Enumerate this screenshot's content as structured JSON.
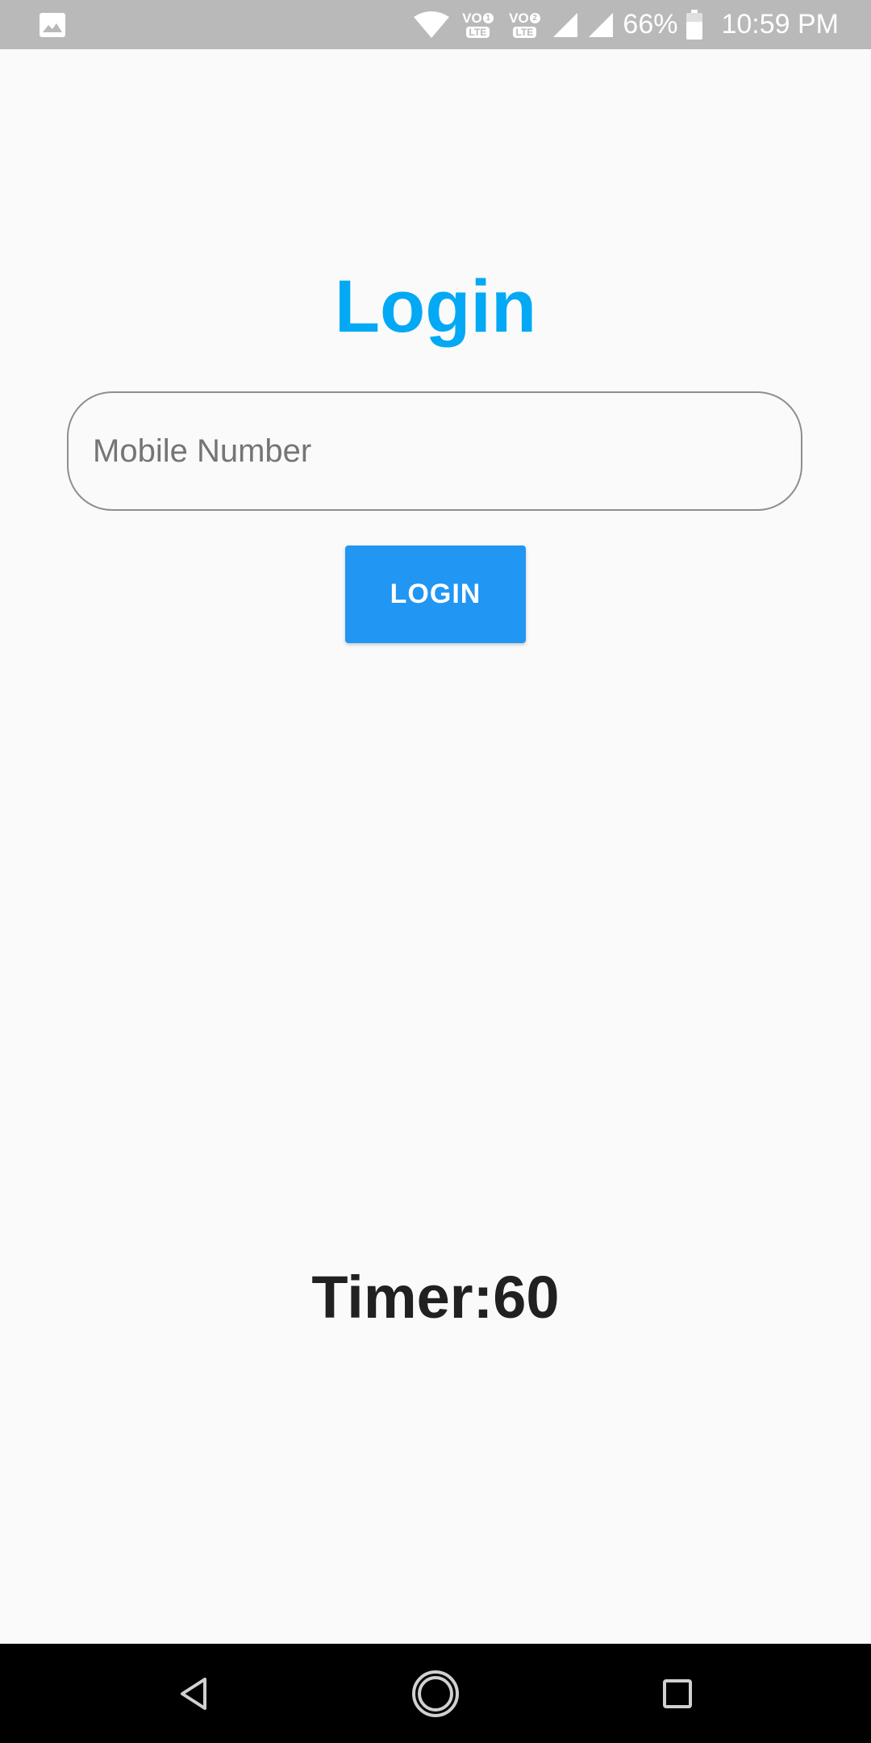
{
  "status_bar": {
    "battery_percent": "66%",
    "time": "10:59 PM",
    "volte1": {
      "vo": "VO",
      "sim": "1",
      "lte": "LTE"
    },
    "volte2": {
      "vo": "VO",
      "sim": "2",
      "lte": "LTE"
    },
    "icons": [
      "gallery-icon",
      "wifi-icon",
      "signal-icon",
      "signal-icon",
      "battery-icon"
    ]
  },
  "login": {
    "title": "Login",
    "mobile_placeholder": "Mobile Number",
    "mobile_value": "",
    "button_label": "LOGIN"
  },
  "timer": {
    "text": "Timer:60"
  },
  "nav_bar": {
    "icons": [
      "back-icon",
      "home-icon",
      "recents-icon"
    ]
  },
  "colors": {
    "title": "#03a9f4",
    "button": "#2196f3",
    "status_bar": "#b9b9b9",
    "background": "#fafafa"
  }
}
